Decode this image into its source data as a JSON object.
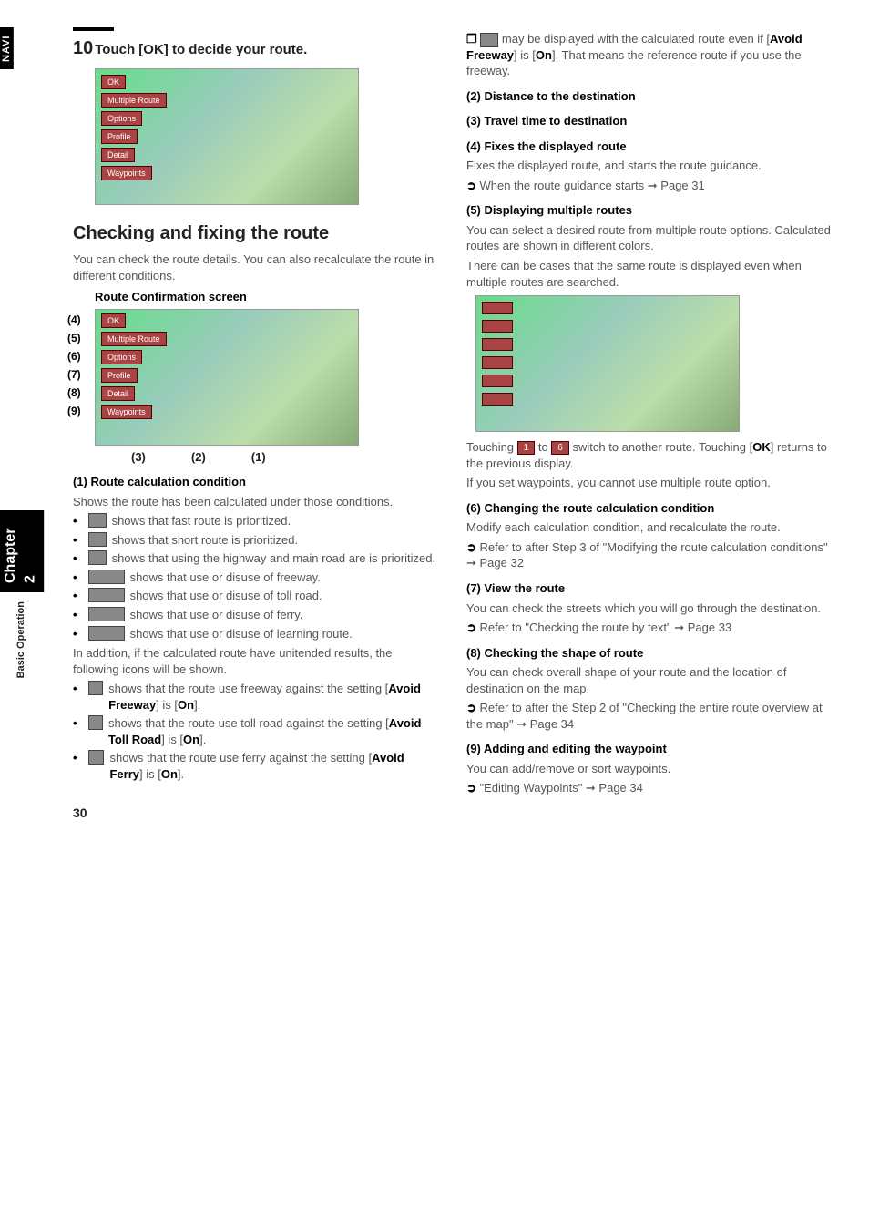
{
  "side": {
    "navi": "NAVI",
    "chapter": "Chapter 2",
    "basic": "Basic Operation"
  },
  "left": {
    "step_num": "10",
    "step_text": "Touch [OK] to decide your route.",
    "shot_buttons": [
      "OK",
      "Multiple Route",
      "Options",
      "Profile",
      "Detail",
      "Waypoints"
    ],
    "section_title": "Checking and fixing the route",
    "section_intro": "You can check the route details. You can also recalculate the route in different conditions.",
    "conf_title": "Route Confirmation screen",
    "callouts_left": [
      "(4)",
      "(5)",
      "(6)",
      "(7)",
      "(8)",
      "(9)"
    ],
    "callouts_bottom": [
      "(3)",
      "(2)",
      "(1)"
    ],
    "h1": "(1) Route calculation condition",
    "h1_body": "Shows the route has been calculated under those conditions.",
    "bul": [
      "shows that fast route is prioritized.",
      "shows that short route is prioritized.",
      "shows that using the highway and main road are is prioritized.",
      "shows that use or disuse of freeway.",
      "shows that use or disuse of toll road.",
      "shows that use or disuse of ferry.",
      "shows that use or disuse of learning route."
    ],
    "addl": "In addition, if the calculated route have unitended results, the following icons will be shown.",
    "bul2a": "shows that the route use freeway against the setting [",
    "bul2a_k": "Avoid Freeway",
    "bul2a_e": "] is [",
    "on": "On",
    "close": "].",
    "bul2b": "shows that the route use toll road against the setting [",
    "bul2b_k": "Avoid Toll Road",
    "bul2c": "shows that the route use ferry against the setting [",
    "bul2c_k": "Avoid Ferry"
  },
  "right": {
    "note1a": "may be displayed with the calculated route even if [",
    "note1k": "Avoid Freeway",
    "note1b": "] is [",
    "note1c": "]. That means the reference route if you use the freeway.",
    "h2": "(2) Distance to the destination",
    "h3": "(3) Travel time to destination",
    "h4": "(4) Fixes the displayed route",
    "h4_body": "Fixes the displayed route, and starts the route guidance.",
    "h4_ref": "When the route guidance starts ➞ Page 31",
    "h5": "(5) Displaying multiple routes",
    "h5_b1": "You can select a desired route from multiple route options. Calculated routes are shown in different colors.",
    "h5_b2": "There can be cases that the same route is displayed even when multiple routes are searched.",
    "touching": "Touching ",
    "to": " to ",
    "switch": " switch to another route. Touching [",
    "ok": "OK",
    "ret": "] returns to the previous display.",
    "wp": "If you set waypoints, you cannot use multiple route option.",
    "h6": "(6) Changing the route calculation condition",
    "h6_body": "Modify each calculation condition, and recalculate the route.",
    "h6_ref": "Refer to after Step 3 of \"Modifying the route calculation conditions\"  ➞ Page 32",
    "h7": "(7) View the route",
    "h7_body": "You can check the streets which you will go through the destination.",
    "h7_ref": "Refer to \"Checking the route by text\" ➞ Page 33",
    "h8": "(8) Checking the shape of route",
    "h8_body": "You can check overall shape of your route and the location of destination on the map.",
    "h8_ref": "Refer to after the Step 2 of \"Checking the entire route overview at the map\" ➞ Page 34",
    "h9": "(9) Adding and editing the waypoint",
    "h9_body": "You can add/remove or sort waypoints.",
    "h9_ref": "\"Editing Waypoints\" ➞ Page 34",
    "pill1": "1",
    "pill6": "6"
  },
  "page": "30"
}
